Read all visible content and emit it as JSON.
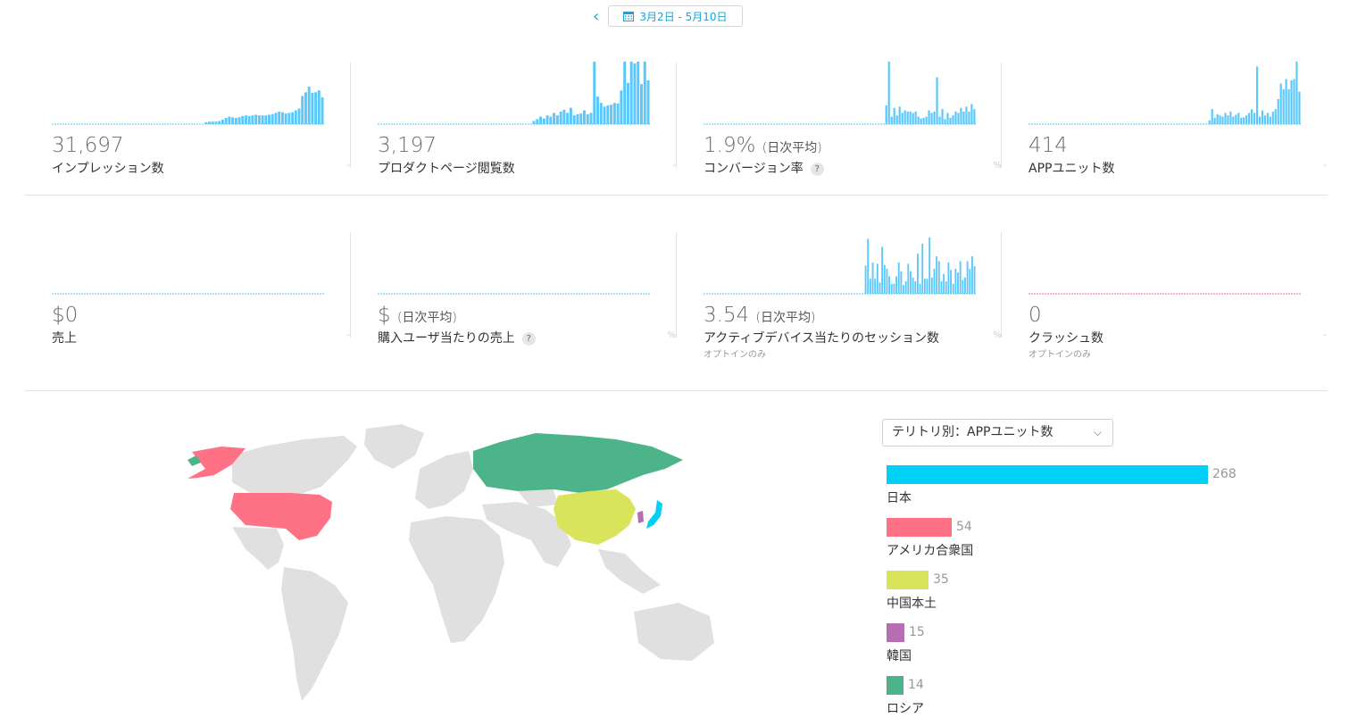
{
  "header": {
    "prev_icon": "chevron-left-icon",
    "calendar_icon": "calendar-icon",
    "date_range": "3月2日 - 5月10日"
  },
  "metrics": [
    {
      "value": "31,697",
      "sub": "",
      "label": "インプレッション数",
      "note": "",
      "unit": "-",
      "help": false,
      "color": "#5ac8fa",
      "bars": [
        0,
        0,
        0,
        0,
        0,
        0,
        0,
        0,
        0,
        0,
        0,
        0,
        0,
        0,
        0,
        0,
        0,
        0,
        0,
        0,
        0,
        0,
        0,
        0,
        0,
        0,
        0,
        0,
        0,
        0,
        0,
        0,
        0,
        0,
        0,
        0,
        0,
        0,
        0,
        0,
        0,
        0,
        0,
        0,
        0,
        0,
        0,
        0,
        0,
        0,
        0,
        0,
        0,
        0,
        0,
        0,
        0,
        0,
        0,
        0,
        0,
        0,
        0,
        0,
        0,
        0,
        0,
        0,
        0,
        0,
        0,
        0,
        0,
        0,
        0,
        0,
        0,
        0,
        0,
        0,
        0,
        0,
        0,
        0,
        0,
        0,
        0,
        0,
        0,
        0,
        0,
        0,
        0,
        0,
        0,
        0,
        0,
        0,
        0,
        0,
        0,
        0,
        0,
        0,
        0,
        0,
        0,
        0,
        0,
        0,
        0,
        0,
        0,
        0,
        0,
        0,
        0,
        0,
        0,
        0,
        0,
        0,
        0,
        0
      ]
    },
    {
      "value": "3,197",
      "sub": "",
      "label": "プロダクトページ閲覧数",
      "note": "",
      "unit": "-",
      "help": false,
      "color": "#5ac8fa",
      "bars": []
    },
    {
      "value": "1.9%",
      "sub": "(日次平均)",
      "label": "コンバージョン率",
      "note": "",
      "unit": "%",
      "help": true,
      "color": "#5ac8fa",
      "bars": []
    },
    {
      "value": "414",
      "sub": "",
      "label": "APPユニット数",
      "note": "",
      "unit": "-",
      "help": false,
      "color": "#5ac8fa",
      "bars": []
    },
    {
      "value": "$0",
      "sub": "",
      "label": "売上",
      "note": "",
      "unit": "-",
      "help": false,
      "color": "#5ac8fa",
      "bars": []
    },
    {
      "value": "$",
      "sub": "(日次平均)",
      "label": "購入ユーザ当たりの売上",
      "note": "",
      "unit": "%",
      "help": true,
      "color": "#5ac8fa",
      "bars": []
    },
    {
      "value": "3.54",
      "sub": "(日次平均)",
      "label": "アクティブデバイス当たりのセッション数",
      "note": "オプトインのみ",
      "unit": "%",
      "help": false,
      "color": "#5ac8fa",
      "bars": []
    },
    {
      "value": "0",
      "sub": "",
      "label": "クラッシュ数",
      "note": "オプトインのみ",
      "unit": "-",
      "help": false,
      "color": "#ff6b81",
      "bars": []
    }
  ],
  "territory": {
    "select_label": "テリトリ別：APPユニット数",
    "chevron_icon": "chevron-down-icon",
    "max": 268,
    "items": [
      {
        "name": "日本",
        "value": 268,
        "color": "#00d0f5"
      },
      {
        "name": "アメリカ合衆国",
        "value": 54,
        "color": "#ff7285"
      },
      {
        "name": "中国本土",
        "value": 35,
        "color": "#d9e45a"
      },
      {
        "name": "韓国",
        "value": 15,
        "color": "#b56fb0"
      },
      {
        "name": "ロシア",
        "value": 14,
        "color": "#4db48a"
      }
    ]
  },
  "map": {
    "base_color": "#e0e0e0",
    "icon": "world-map"
  }
}
